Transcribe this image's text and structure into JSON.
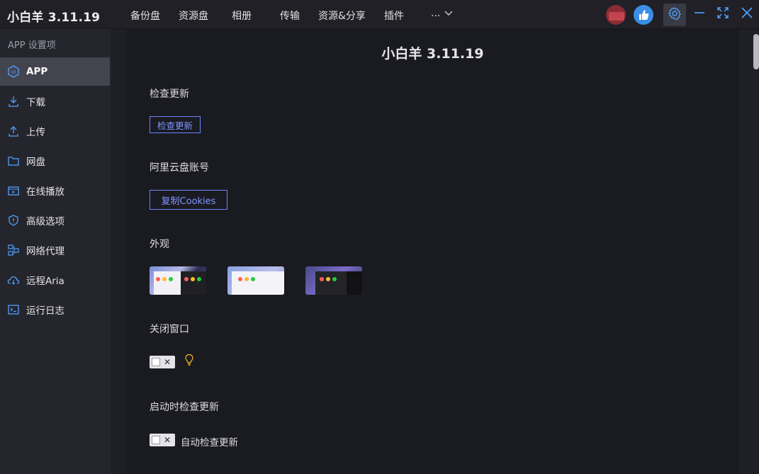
{
  "app": {
    "title": "小白羊 3.11.19"
  },
  "nav": {
    "items": [
      "备份盘",
      "资源盘",
      "相册",
      "传输",
      "资源&分享",
      "插件"
    ],
    "more_label": "..."
  },
  "sidebar": {
    "header": "APP 设置项",
    "items": [
      {
        "label": "APP",
        "icon": "app-ui-icon",
        "active": true
      },
      {
        "label": "下载",
        "icon": "download-icon"
      },
      {
        "label": "上传",
        "icon": "upload-icon"
      },
      {
        "label": "网盘",
        "icon": "folder-icon"
      },
      {
        "label": "在线播放",
        "icon": "video-player-icon"
      },
      {
        "label": "高级选项",
        "icon": "shield-info-icon"
      },
      {
        "label": "网络代理",
        "icon": "network-proxy-icon"
      },
      {
        "label": "远程Aria",
        "icon": "cloud-icon"
      },
      {
        "label": "运行日志",
        "icon": "terminal-icon"
      }
    ]
  },
  "main": {
    "title": "小白羊 3.11.19",
    "check_update": {
      "heading": "检查更新",
      "button": "检查更新"
    },
    "account": {
      "heading": "阿里云盘账号",
      "button": "复制Cookies"
    },
    "appearance": {
      "heading": "外观"
    },
    "close_window": {
      "heading": "关闭窗口"
    },
    "startup_check": {
      "heading": "启动时检查更新",
      "toggle_label": "自动检查更新"
    }
  },
  "colors": {
    "accent": "#6b86ff",
    "active_bg": "#44444f",
    "sidebar_bg": "#25252d",
    "main_bg": "#1a1a21"
  }
}
